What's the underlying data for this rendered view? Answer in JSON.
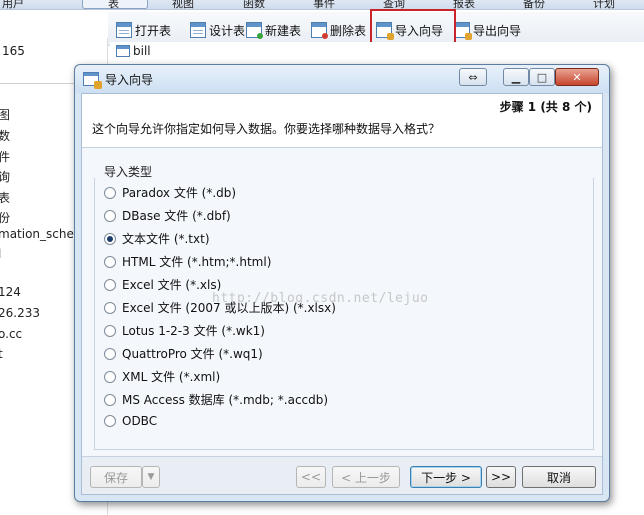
{
  "menu": {
    "items": [
      "用户",
      "表",
      "视图",
      "函数",
      "事件",
      "查询",
      "报表",
      "备份",
      "计划"
    ]
  },
  "toolbar": {
    "open_table": "打开表",
    "design_table": "设计表",
    "new_table": "新建表",
    "delete_table": "删除表",
    "import_wizard": "导入向导",
    "export_wizard": "导出向导"
  },
  "left_panel": {
    "top_value": "165",
    "items": [
      "图",
      "数",
      "件",
      "询",
      "表",
      "份",
      "mation_schem",
      "l",
      "124",
      "26.233",
      "o.cc",
      "t"
    ]
  },
  "object_list": {
    "items": [
      "bill"
    ]
  },
  "dialog": {
    "title": "导入向导",
    "step": "步骤 1 (共 8 个)",
    "question": "这个向导允许你指定如何导入数据。你要选择哪种数据导入格式？",
    "group_label": "导入类型",
    "selected": 2,
    "options": [
      "Paradox 文件 (*.db)",
      "DBase 文件 (*.dbf)",
      "文本文件 (*.txt)",
      "HTML 文件 (*.htm;*.html)",
      "Excel 文件 (*.xls)",
      "Excel 文件 (2007 或以上版本) (*.xlsx)",
      "Lotus 1-2-3 文件 (*.wk1)",
      "QuattroPro 文件 (*.wq1)",
      "XML 文件 (*.xml)",
      "MS Access 数据库 (*.mdb; *.accdb)",
      "ODBC"
    ],
    "watermark": "http://blog.csdn.net/lejuo",
    "buttons": {
      "save": "保存",
      "first": "<<",
      "prev": "< 上一步",
      "next": "下一步 >",
      "last": ">>",
      "cancel": "取消"
    }
  }
}
